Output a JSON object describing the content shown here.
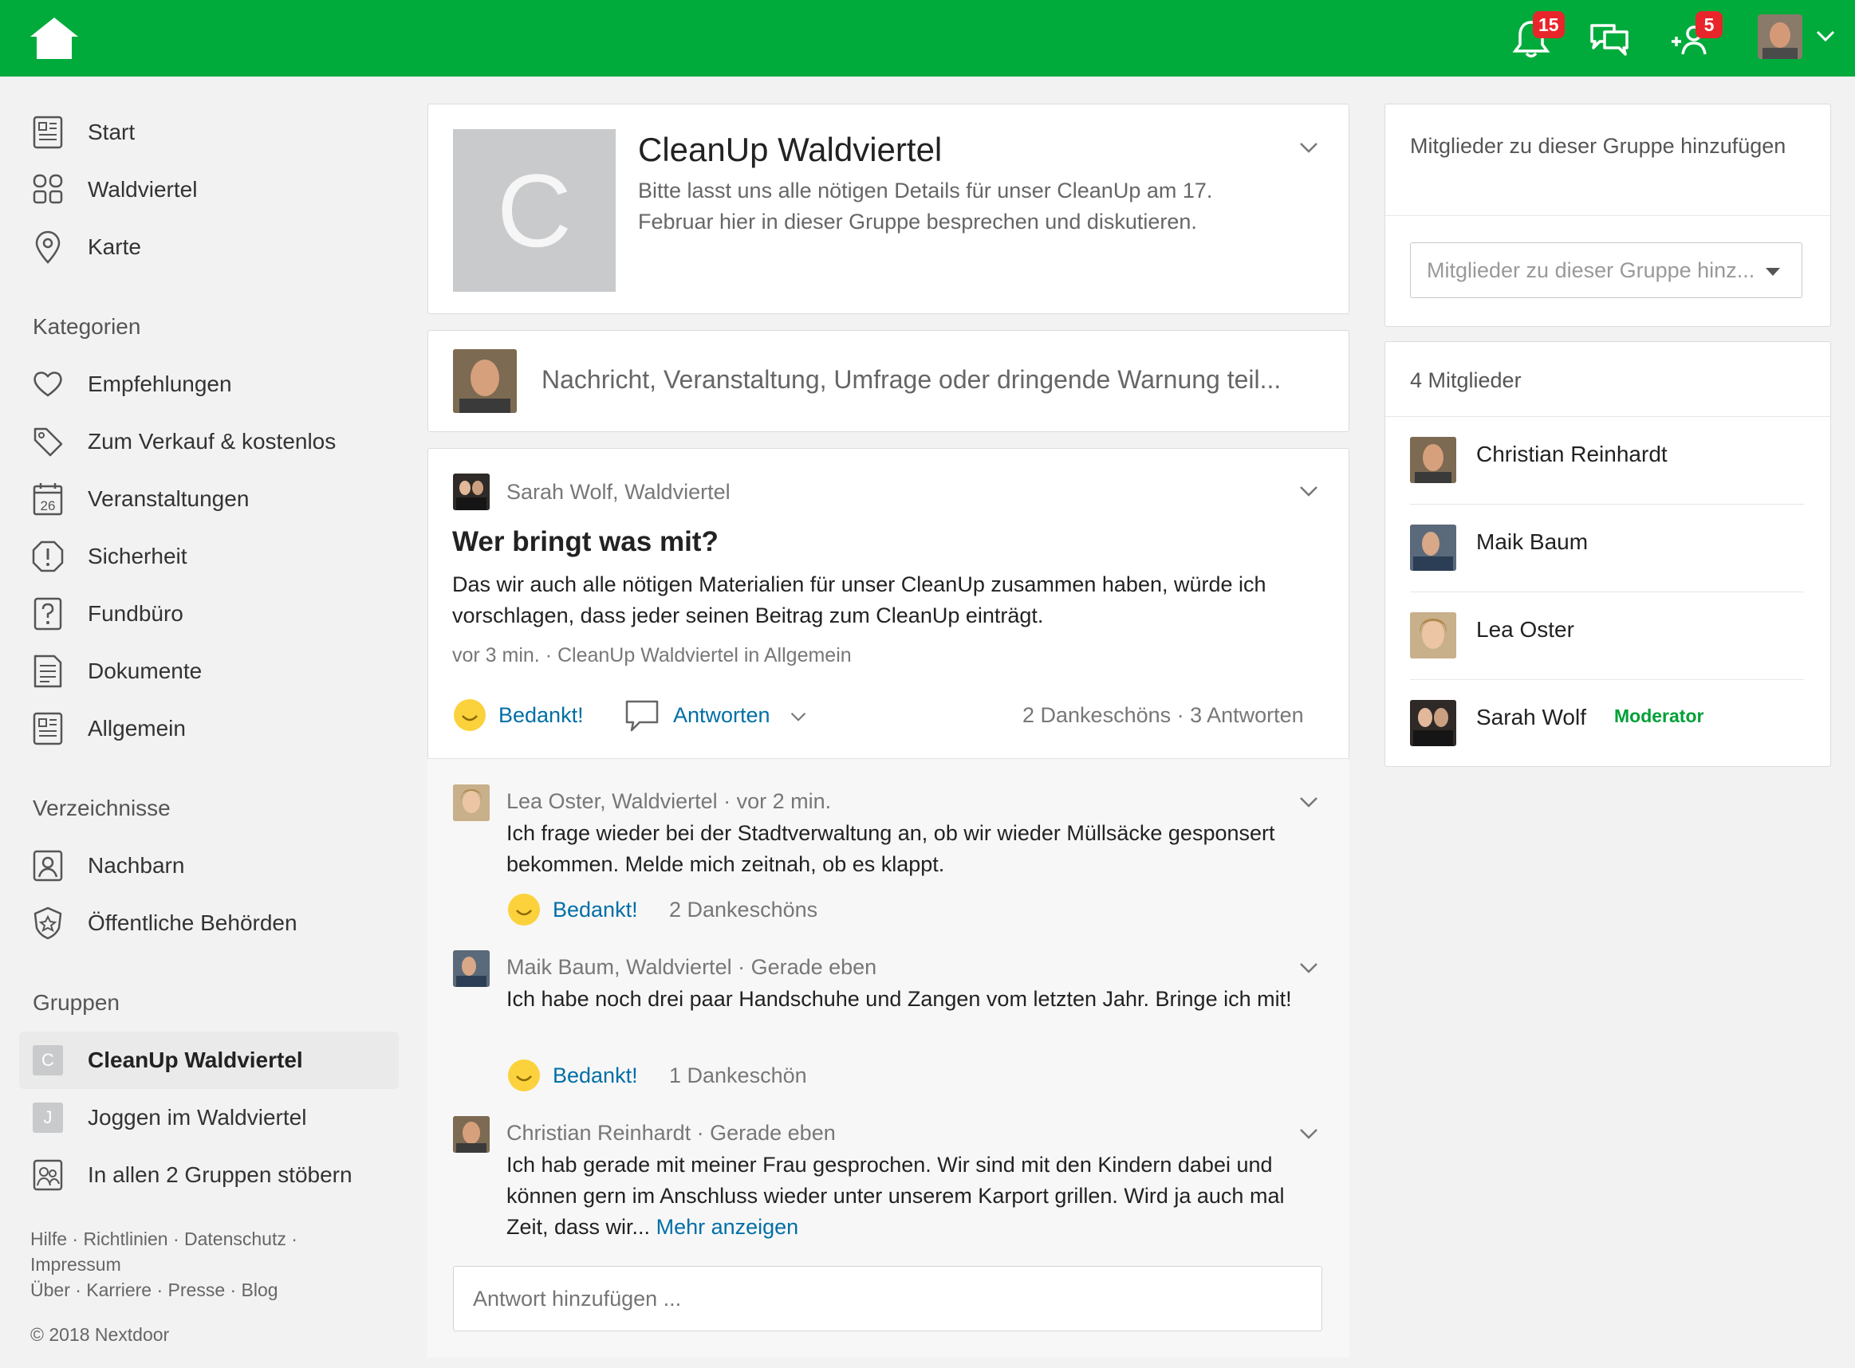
{
  "topbar": {
    "notifications_count": "15",
    "requests_count": "5"
  },
  "sidebar": {
    "main": [
      {
        "label": "Start",
        "icon": "newspaper-icon"
      },
      {
        "label": "Waldviertel",
        "icon": "neighbors-icon"
      },
      {
        "label": "Karte",
        "icon": "map-pin-icon"
      }
    ],
    "categories_title": "Kategorien",
    "categories": [
      {
        "label": "Empfehlungen",
        "icon": "heart-icon"
      },
      {
        "label": "Zum Verkauf & kostenlos",
        "icon": "tag-icon"
      },
      {
        "label": "Veranstaltungen",
        "icon": "calendar-icon",
        "icon_text": "26"
      },
      {
        "label": "Sicherheit",
        "icon": "alert-icon"
      },
      {
        "label": "Fundbüro",
        "icon": "question-icon"
      },
      {
        "label": "Dokumente",
        "icon": "document-icon"
      },
      {
        "label": "Allgemein",
        "icon": "newspaper-icon"
      }
    ],
    "directories_title": "Verzeichnisse",
    "directories": [
      {
        "label": "Nachbarn",
        "icon": "person-icon"
      },
      {
        "label": "Öffentliche Behörden",
        "icon": "badge-icon"
      }
    ],
    "groups_title": "Gruppen",
    "groups": [
      {
        "label": "CleanUp Waldviertel",
        "letter": "C",
        "active": true
      },
      {
        "label": "Joggen im Waldviertel",
        "letter": "J",
        "active": false
      },
      {
        "label": "In allen 2 Gruppen stöbern",
        "icon": "groups-icon"
      }
    ],
    "footer": {
      "line1": "Hilfe · Richtlinien · Datenschutz ·",
      "line2": "Impressum",
      "line3": "Über · Karriere · Presse · Blog",
      "copyright": "© 2018 Nextdoor"
    }
  },
  "group": {
    "letter": "C",
    "title": "CleanUp Waldviertel",
    "description": "Bitte lasst uns alle nötigen Details für unser CleanUp am 17. Februar hier in dieser Gruppe besprechen und diskutieren."
  },
  "composer": {
    "placeholder": "Nachricht, Veranstaltung, Umfrage oder dringende Warnung teil..."
  },
  "post": {
    "author": "Sarah Wolf, Waldviertel",
    "title": "Wer bringt was mit?",
    "body": "Das wir auch alle nötigen Materialien für unser CleanUp zusammen haben, würde ich vorschlagen, dass jeder seinen Beitrag zum CleanUp einträgt.",
    "meta": "vor 3 min.  ·  CleanUp Waldviertel in Allgemein",
    "thank_label": "Bedankt!",
    "reply_label": "Antworten",
    "stats": "2 Dankeschöns · 3 Antworten"
  },
  "comments": [
    {
      "header": "Lea Oster, Waldviertel · vor 2 min.",
      "text": "Ich frage wieder bei der Stadtverwaltung an, ob wir wieder Müllsäcke gesponsert bekommen. Melde mich zeitnah, ob es klappt.",
      "thank_label": "Bedankt!",
      "thanks": "2 Dankeschöns"
    },
    {
      "header": "Maik Baum, Waldviertel · Gerade eben",
      "text": "Ich habe noch drei paar Handschuhe und Zangen vom letzten Jahr. Bringe ich mit!",
      "thank_label": "Bedankt!",
      "thanks": "1 Dankeschön"
    },
    {
      "header": "Christian Reinhardt · Gerade eben",
      "text": "Ich hab gerade mit meiner Frau gesprochen. Wir sind mit den Kindern dabei und können gern im Anschluss wieder unter unserem Karport grillen. Wird ja auch mal Zeit, dass wir...",
      "more": "Mehr anzeigen"
    }
  ],
  "reply_input": {
    "placeholder": "Antwort hinzufügen ..."
  },
  "right": {
    "add_title": "Mitglieder zu dieser Gruppe hinzufügen",
    "add_placeholder": "Mitglieder zu dieser Gruppe hinz...",
    "members_title": "4 Mitglieder",
    "members": [
      {
        "name": "Christian Reinhardt"
      },
      {
        "name": "Maik Baum"
      },
      {
        "name": "Lea Oster"
      },
      {
        "name": "Sarah Wolf",
        "role": "Moderator"
      }
    ]
  },
  "colors": {
    "brand_green": "#00ab3c",
    "badge_red": "#e8252a",
    "link_blue": "#006fa6",
    "moderator_green": "#00a038"
  }
}
